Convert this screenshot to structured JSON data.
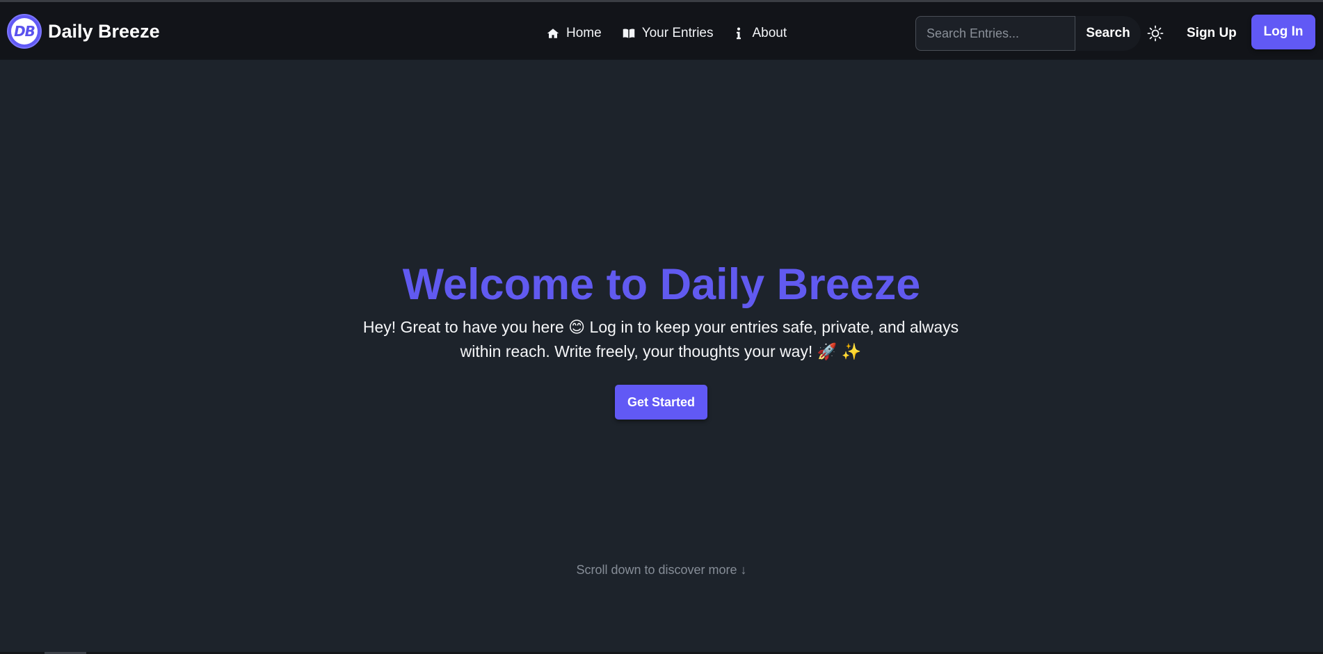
{
  "navbar": {
    "brand": {
      "logo_text": "DB",
      "name": "Daily Breeze"
    },
    "links": [
      {
        "label": "Home",
        "icon": "home-icon"
      },
      {
        "label": "Your Entries",
        "icon": "book-icon"
      },
      {
        "label": "About",
        "icon": "info-icon"
      }
    ],
    "search": {
      "placeholder": "Search Entries...",
      "value": "",
      "button_label": "Search"
    },
    "theme_toggle_icon": "sun-icon",
    "signup_label": "Sign Up",
    "login_label": "Log In"
  },
  "hero": {
    "title": "Welcome to Daily Breeze",
    "text": "Hey! Great to have you here 😊 Log in to keep your entries safe, private, and always within reach. Write freely, your thoughts your way! 🚀 ✨",
    "cta_label": "Get Started",
    "scroll_hint": "Scroll down to discover more ↓"
  },
  "colors": {
    "accent": "#6159f5",
    "background": "#1d232b",
    "navbar": "#121419"
  }
}
